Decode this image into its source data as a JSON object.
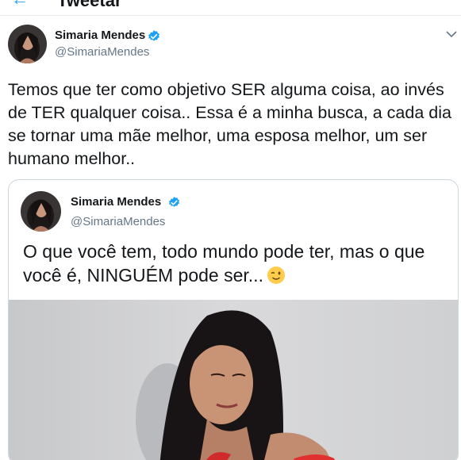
{
  "header": {
    "title": "Tweetar",
    "back_icon": "arrow-left-icon"
  },
  "tweet": {
    "author_name": "Simaria Mendes",
    "author_handle": "@SimariaMendes",
    "verified_icon": "verified-badge-icon",
    "menu_icon": "chevron-down-icon",
    "text": "Temos que ter como objetivo SER alguma coisa, ao invés de TER qualquer coisa.. Essa é a minha busca, a cada dia se tornar uma mãe melhor, uma esposa melhor, um ser humano melhor.."
  },
  "quoted_tweet": {
    "author_name": "Simaria Mendes",
    "author_handle": "@SimariaMendes",
    "text": "O que você tem, todo mundo pode ter, mas o que você é, NINGUÉM pode ser...",
    "emoji_icon": "winking-face-emoji"
  },
  "colors": {
    "accent": "#1da1f2",
    "text": "#14171a",
    "secondary": "#657786",
    "border": "#ccd6dd"
  }
}
